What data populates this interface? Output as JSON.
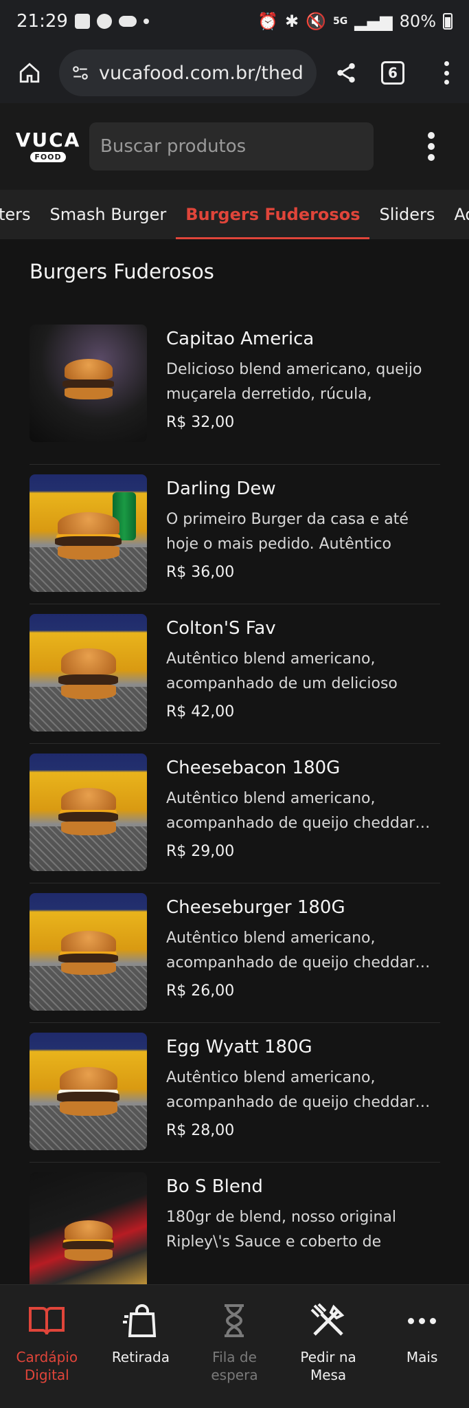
{
  "status_bar": {
    "time": "21:29",
    "network": "5G",
    "battery": "80%"
  },
  "browser": {
    "url": "vucafood.com.br/thed",
    "tab_count": "6"
  },
  "header": {
    "logo_top": "VUCA",
    "logo_bottom": "FOOD",
    "search_placeholder": "Buscar produtos"
  },
  "categories": [
    {
      "label": "ters",
      "active": false
    },
    {
      "label": "Smash Burger",
      "active": false
    },
    {
      "label": "Burgers Fuderosos",
      "active": true
    },
    {
      "label": "Sliders",
      "active": false
    },
    {
      "label": "Adicionais",
      "active": false
    }
  ],
  "section": {
    "title": "Burgers Fuderosos"
  },
  "products": [
    {
      "name": "Capitao America",
      "desc": "Delicioso blend americano, queijo muçarela derretido, rúcula, costela…",
      "price": "R$ 32,00"
    },
    {
      "name": "Darling Dew",
      "desc": "O primeiro Burger da casa e até hoje o mais pedido. Autêntico blend…",
      "price": "R$ 36,00"
    },
    {
      "name": "Colton'S Fav",
      "desc": "Autêntico blend americano, acompanhado de um delicioso que…",
      "price": "R$ 42,00"
    },
    {
      "name": "Cheesebacon 180G",
      "desc": "Autêntico blend americano, acompanhado de queijo cheddar…",
      "price": "R$ 29,00"
    },
    {
      "name": "Cheeseburger 180G",
      "desc": "Autêntico blend americano, acompanhado de queijo cheddar…",
      "price": "R$ 26,00"
    },
    {
      "name": "Egg Wyatt 180G",
      "desc": "Autêntico blend americano, acompanhado de queijo cheddar…",
      "price": "R$ 28,00"
    },
    {
      "name": "Bo S Blend",
      "desc": "180gr de blend, nosso original Ripley\\'s Sauce e coberto de queijo…",
      "price": ""
    }
  ],
  "bottom_nav": [
    {
      "label": "Cardápio Digital",
      "icon": "book-icon",
      "state": "active"
    },
    {
      "label": "Retirada",
      "icon": "shopping-bag-icon",
      "state": "normal"
    },
    {
      "label": "Fila de espera",
      "icon": "hourglass-icon",
      "state": "disabled"
    },
    {
      "label": "Pedir na Mesa",
      "icon": "utensils-icon",
      "state": "normal"
    },
    {
      "label": "Mais",
      "icon": "more-icon",
      "state": "normal"
    }
  ],
  "colors": {
    "accent": "#e0453a",
    "background": "#141414"
  }
}
